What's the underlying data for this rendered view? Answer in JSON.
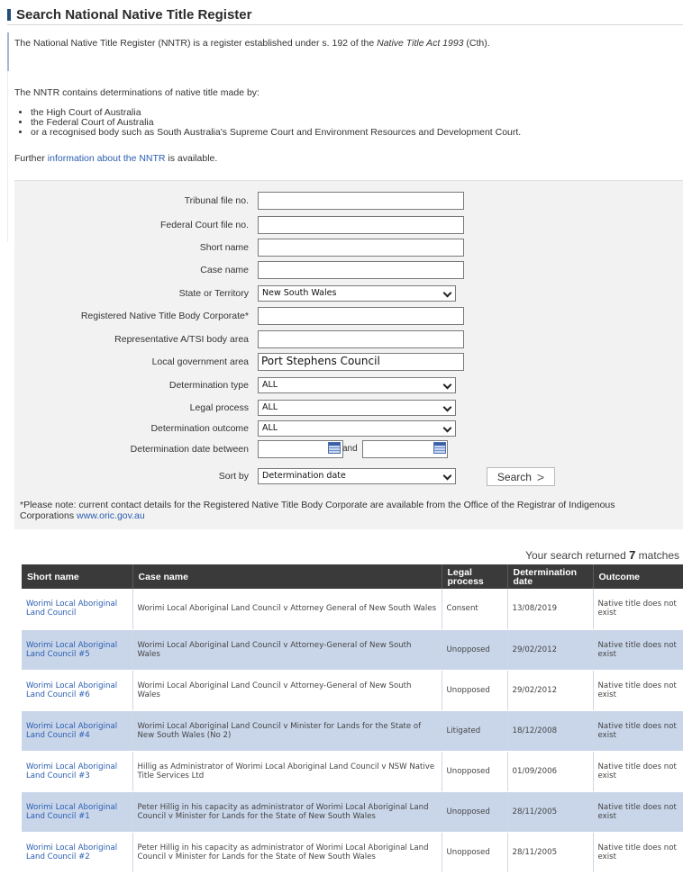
{
  "page": {
    "title": "Search National Native Title Register",
    "intro_pre": "The National Native Title Register (NNTR) is a register established under s. 192 of the ",
    "intro_act": "Native Title Act 1993",
    "intro_post": " (Cth).",
    "nntr_line": "The NNTR contains determinations of native title made by:",
    "bullets": [
      "the High Court of Australia",
      "the Federal Court of Australia",
      "or a recognised body such as South Australia's Supreme Court and Environment Resources and Development Court."
    ],
    "further_pre": "Further ",
    "further_link": "information about the NNTR",
    "further_post": " is available."
  },
  "form": {
    "tribunal_file_label": "Tribunal file no.",
    "tribunal_file_value": "",
    "federal_court_label": "Federal Court file no.",
    "federal_court_value": "",
    "short_name_label": "Short name",
    "short_name_value": "",
    "case_name_label": "Case name",
    "case_name_value": "",
    "state_label": "State or Territory",
    "state_value": "New South Wales",
    "rntbc_label": "Registered Native Title Body Corporate*",
    "rntbc_value": "",
    "rep_body_label": "Representative A/TSI body area",
    "rep_body_value": "",
    "lga_label": "Local government area",
    "lga_value": "Port Stephens Council",
    "det_type_label": "Determination type",
    "det_type_value": "ALL",
    "legal_process_label": "Legal process",
    "legal_process_value": "ALL",
    "outcome_label": "Determination outcome",
    "outcome_value": "ALL",
    "date_label": "Determination date between",
    "date_from": "",
    "date_and": "and",
    "date_to": "",
    "sort_label": "Sort by",
    "sort_value": "Determination date",
    "search_label": "Search",
    "note_text": "*Please note: current contact details for the Registered Native Title Body Corporate are available from the Office of the Registrar of Indigenous Corporations ",
    "note_link": "www.oric.gov.au"
  },
  "results": {
    "prefix": "Your search returned ",
    "count": "7",
    "suffix": " matches",
    "headers": [
      "Short name",
      "Case name",
      "Legal process",
      "Determination date",
      "Outcome"
    ],
    "rows": [
      [
        "Worimi Local Aboriginal Land Council",
        "Worimi Local Aboriginal Land Council v Attorney General of New South Wales",
        "Consent",
        "13/08/2019",
        "Native title does not exist"
      ],
      [
        "Worimi Local Aboriginal Land Council #5",
        "Worimi Local Aboriginal Land Council v Attorney-General of New South Wales",
        "Unopposed",
        "29/02/2012",
        "Native title does not exist"
      ],
      [
        "Worimi Local Aboriginal Land Council #6",
        "Worimi Local Aboriginal Land Council v Attorney-General of New South Wales",
        "Unopposed",
        "29/02/2012",
        "Native title does not exist"
      ],
      [
        "Worimi Local Aboriginal Land Council #4",
        "Worimi Local Aboriginal Land Council v Minister for Lands for the State of New South Wales (No 2)",
        "Litigated",
        "18/12/2008",
        "Native title does not exist"
      ],
      [
        "Worimi Local Aboriginal Land Council #3",
        "Hillig as Administrator of Worimi Local Aboriginal Land Council v NSW Native Title Services Ltd",
        "Unopposed",
        "01/09/2006",
        "Native title does not exist"
      ],
      [
        "Worimi Local Aboriginal Land Council #1",
        "Peter Hillig in his capacity as administrator of Worimi Local Aboriginal Land Council v Minister for Lands for the State of New South Wales",
        "Unopposed",
        "28/11/2005",
        "Native title does not exist"
      ],
      [
        "Worimi Local Aboriginal Land Council #2",
        "Peter Hillig in his capacity as administrator of Worimi Local Aboriginal Land Council v Minister for Lands for the State of New South Wales",
        "Unopposed",
        "28/11/2005",
        "Native title does not exist"
      ]
    ]
  },
  "colors": {
    "header_bg": "#3a3a3a",
    "alt_row": "#c9d6ea",
    "link": "#2a5db0",
    "accent_bar": "#1f4e79"
  }
}
